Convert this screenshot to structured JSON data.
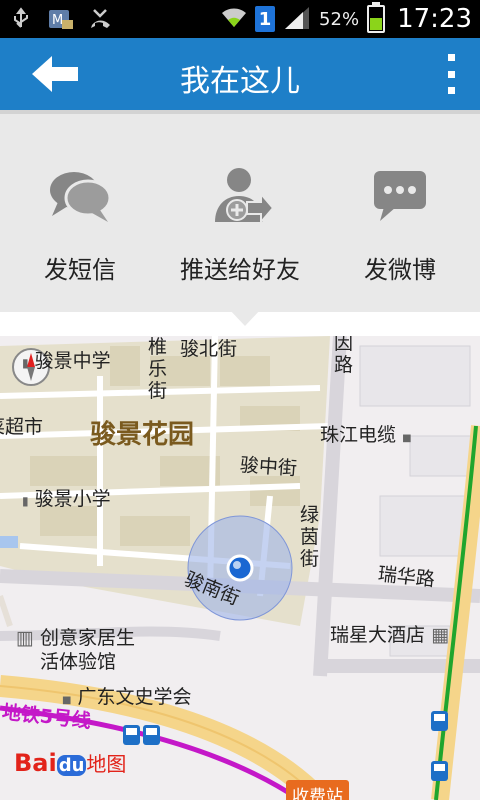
{
  "status_bar": {
    "battery_percent": "52%",
    "battery_level": 0.52,
    "time": "17:23",
    "sim_badge": "1"
  },
  "app_bar": {
    "title": "我在这儿"
  },
  "share_panel": {
    "items": [
      {
        "label": "发短信",
        "icon": "chat-bubbles-icon"
      },
      {
        "label": "推送给好友",
        "icon": "user-share-icon"
      },
      {
        "label": "发微博",
        "icon": "microblog-icon"
      }
    ]
  },
  "map": {
    "labels": {
      "school_mid": "骏景中学",
      "road_a": "椎乐街",
      "road_north": "骏北街",
      "road_b": "因路",
      "supermarket": "菜超市",
      "garden": "骏景花园",
      "cable": "珠江电缆",
      "road_mid": "骏中街",
      "school_pri": "骏景小学",
      "road_green": "绿茵街",
      "road_rh": "瑞华路",
      "road_south": "骏南街",
      "hotel": "瑞星大酒店",
      "furniture_1": "创意家居生",
      "furniture_2": "活体验馆",
      "gd_society": "广东文史学会",
      "metro": "地铁5号线",
      "toll": "收费站",
      "baidu_1": "Bai",
      "baidu_2": "du",
      "baidu_3": "地图"
    }
  }
}
